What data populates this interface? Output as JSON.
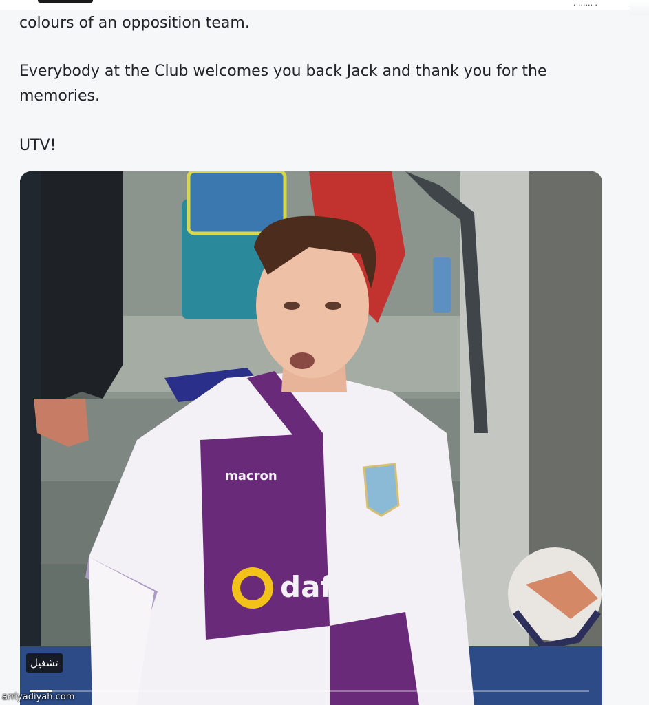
{
  "tweet": {
    "line_1": "colours of an opposition team.",
    "line_2": "Everybody at the Club welcomes you back Jack and thank you for the",
    "line_3": "memories.",
    "line_4": "UTV!"
  },
  "video": {
    "play_label": "تشغيل",
    "progress_fraction": 0.04,
    "shirt_sponsor": "dafabet",
    "shirt_maker": "macron"
  },
  "watermark": "arriyadiyah.com",
  "colors": {
    "background": "#f6f7f9",
    "text": "#1f2226",
    "shirt_purple": "#6a2a7a",
    "shirt_white": "#f3f0f6"
  }
}
